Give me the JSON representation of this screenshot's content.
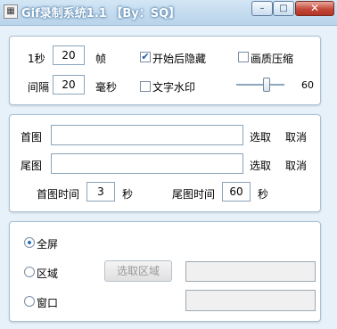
{
  "window": {
    "title": "Gif录制系统1.1 【By：SQ】",
    "icon": "app-icon",
    "min_label": "–",
    "max_label": "□",
    "close_label": "✕"
  },
  "recording": {
    "fps_label": "1秒",
    "fps_value": "20",
    "fps_unit": "帧",
    "interval_label": "间隔",
    "interval_value": "20",
    "interval_unit": "毫秒",
    "hide_after_start_label": "开始后隐藏",
    "hide_after_start_checked": true,
    "quality_compress_label": "画质压缩",
    "quality_compress_checked": false,
    "text_watermark_label": "文字水印",
    "text_watermark_checked": false,
    "slider_value_label": "60"
  },
  "images": {
    "first_label": "首图",
    "first_value": "",
    "first_select": "选取",
    "first_cancel": "取消",
    "last_label": "尾图",
    "last_value": "",
    "last_select": "选取",
    "last_cancel": "取消",
    "first_time_label": "首图时间",
    "first_time_value": "3",
    "first_time_unit": "秒",
    "last_time_label": "尾图时间",
    "last_time_value": "60",
    "last_time_unit": "秒"
  },
  "capture": {
    "fullscreen_label": "全屏",
    "region_label": "区域",
    "window_label": "窗口",
    "selected": "fullscreen",
    "select_region_button": "选取区域",
    "region_value": "",
    "window_value": ""
  }
}
